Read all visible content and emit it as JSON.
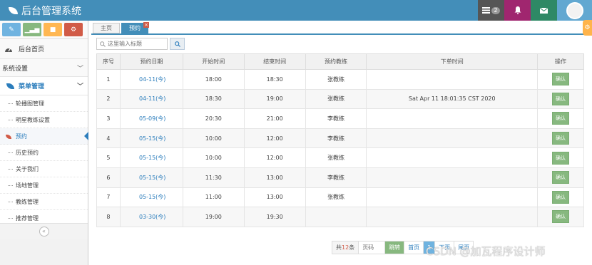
{
  "app": {
    "title": "后台管理系统"
  },
  "header": {
    "message_count": "2"
  },
  "sidebar": {
    "home_label": "后台首页",
    "system_settings": "系统设置",
    "menu_management": "菜单管理",
    "sub_items": [
      {
        "label": "轮播图管理"
      },
      {
        "label": "明星教练设置"
      },
      {
        "label": "预约"
      },
      {
        "label": "历史预约"
      },
      {
        "label": "关于我们"
      },
      {
        "label": "场地管理"
      },
      {
        "label": "教练管理"
      },
      {
        "label": "推荐管理"
      }
    ]
  },
  "tabs": [
    {
      "label": "主页"
    },
    {
      "label": "预约"
    }
  ],
  "tab_close": "×",
  "search": {
    "placeholder": "这里输入标题"
  },
  "table": {
    "columns": [
      "序号",
      "预约日期",
      "开始时间",
      "结束时间",
      "预约教练",
      "下单时间",
      "操作"
    ],
    "rows": [
      {
        "no": "1",
        "date": "04-11(今)",
        "start": "18:00",
        "end": "18:30",
        "coach": "张教练",
        "order_time": "",
        "action": "确认"
      },
      {
        "no": "2",
        "date": "04-11(今)",
        "start": "18:30",
        "end": "19:00",
        "coach": "张教练",
        "order_time": "Sat Apr 11 18:01:35 CST 2020",
        "action": "确认"
      },
      {
        "no": "3",
        "date": "05-09(今)",
        "start": "20:30",
        "end": "21:00",
        "coach": "李教练",
        "order_time": "",
        "action": "确认"
      },
      {
        "no": "4",
        "date": "05-15(今)",
        "start": "10:00",
        "end": "12:00",
        "coach": "李教练",
        "order_time": "",
        "action": "确认"
      },
      {
        "no": "5",
        "date": "05-15(今)",
        "start": "10:00",
        "end": "12:00",
        "coach": "张教练",
        "order_time": "",
        "action": "确认"
      },
      {
        "no": "6",
        "date": "05-15(今)",
        "start": "11:30",
        "end": "13:00",
        "coach": "李教练",
        "order_time": "",
        "action": "确认"
      },
      {
        "no": "7",
        "date": "05-15(今)",
        "start": "11:00",
        "end": "13:00",
        "coach": "张教练",
        "order_time": "",
        "action": "确认"
      },
      {
        "no": "8",
        "date": "03-30(今)",
        "start": "19:00",
        "end": "19:30",
        "coach": "",
        "order_time": "",
        "action": "确认"
      }
    ]
  },
  "pagination": {
    "total_prefix": "共",
    "total_count": "12",
    "total_suffix": "条",
    "page_placeholder": "页码",
    "go_label": "跳转",
    "first_label": "首页",
    "current_page": "1",
    "next_label": "下页",
    "last_label": "尾页"
  },
  "watermark": "CSDN @加瓦程序设计师",
  "icons": {
    "brand": "leaf-icon",
    "messages": "list-icon",
    "notifications": "bell-icon",
    "mail": "envelope-icon",
    "home": "tachometer-icon",
    "menu": "leaf-icon",
    "search": "search-icon",
    "settings": "cog-icon",
    "collapse": "double-chevron-left-icon"
  },
  "colors": {
    "primary": "#438eb9",
    "link": "#2b7dbc",
    "success": "#87b87f",
    "danger": "#d15b47",
    "warning": "#ffb752",
    "info": "#6fb3e0",
    "bell_bg": "#a0266f",
    "mail_bg": "#2e8965"
  }
}
